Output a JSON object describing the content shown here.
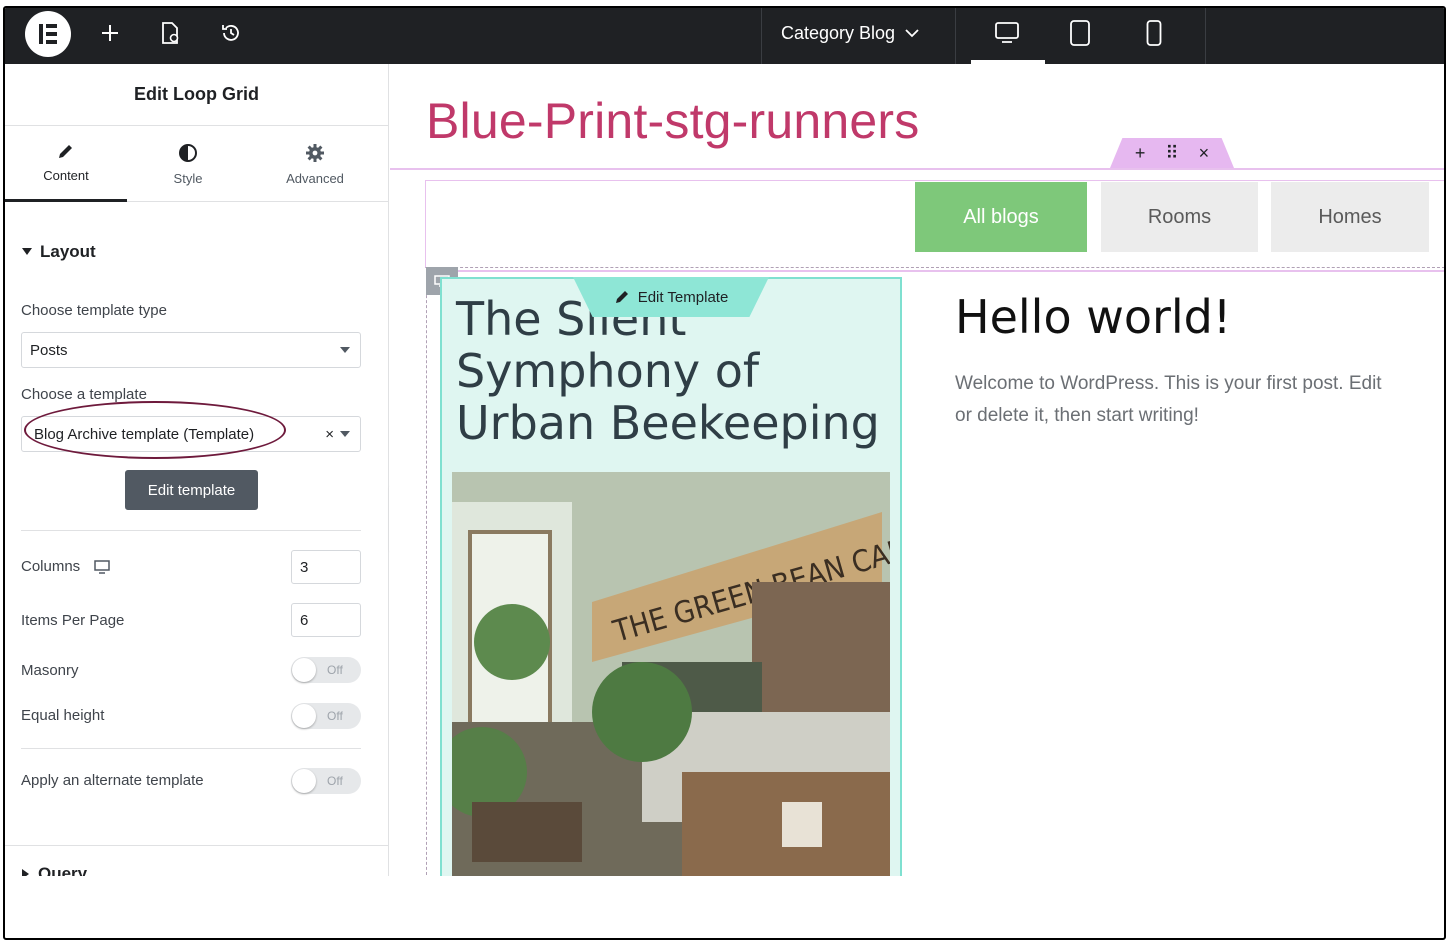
{
  "topbar": {
    "add_label": "+",
    "doc_title": "Category Blog",
    "devices": [
      "desktop",
      "tablet",
      "mobile"
    ]
  },
  "panel": {
    "title": "Edit Loop Grid",
    "tabs": [
      {
        "label": "Content",
        "icon": "pencil-icon"
      },
      {
        "label": "Style",
        "icon": "half-circle-icon"
      },
      {
        "label": "Advanced",
        "icon": "gear-icon"
      }
    ],
    "layout": {
      "section_title": "Layout",
      "template_type_label": "Choose template type",
      "template_type_value": "Posts",
      "template_label": "Choose a template",
      "template_value": "Blog Archive template (Template)",
      "clear_glyph": "×",
      "edit_button": "Edit template",
      "columns_label": "Columns",
      "columns_value": "3",
      "items_label": "Items Per Page",
      "items_value": "6",
      "masonry_label": "Masonry",
      "masonry_state": "Off",
      "equal_height_label": "Equal height",
      "equal_height_state": "Off",
      "alternate_label": "Apply an alternate template",
      "alternate_state": "Off"
    },
    "query_section_title": "Query"
  },
  "canvas": {
    "site_title": "Blue-Print-stg-runners",
    "handle": {
      "add": "+",
      "move": "⠿",
      "close": "×"
    },
    "filters": [
      {
        "label": "All blogs",
        "active": true
      },
      {
        "label": "Rooms",
        "active": false
      },
      {
        "label": "Homes",
        "active": false
      }
    ],
    "edit_template_label": "Edit Template",
    "card_title": "The Silent Symphony of Urban Beekeeping",
    "photo_sign": "THE GREEN BEAN CAFÉ",
    "post_title": "Hello world!",
    "post_excerpt": "Welcome to WordPress. This is your first post. Edit or delete it, then start writing!"
  },
  "colors": {
    "topbar_bg": "#1f2124",
    "site_title": "#c0396a",
    "filter_active": "#7ec87a",
    "card_bg": "#dff6f1",
    "highlight_oval": "#6e1a3c"
  }
}
